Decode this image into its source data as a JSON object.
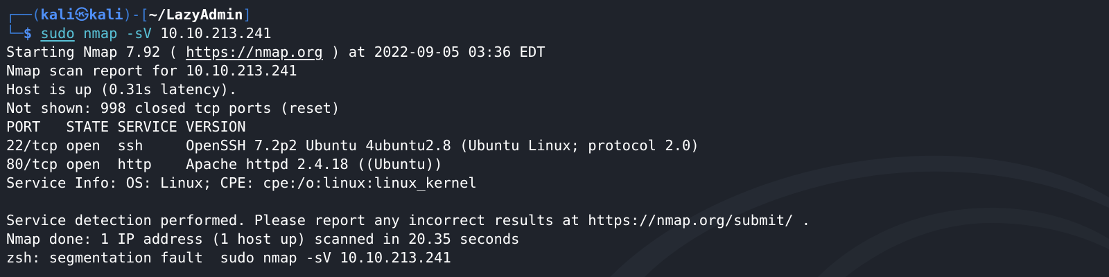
{
  "prompt": {
    "user": "kali",
    "symbol": "㉿",
    "host": "kali",
    "path": "~/LazyAdmin",
    "dollar": "$",
    "command_sudo": "sudo",
    "command_bin": "nmap -sV",
    "command_arg": "10.10.213.241"
  },
  "output": {
    "starting_prefix": "Starting Nmap 7.92 ( ",
    "starting_url": "https://nmap.org",
    "starting_suffix": " ) at 2022-09-05 03:36 EDT",
    "lines": [
      "Nmap scan report for 10.10.213.241",
      "Host is up (0.31s latency).",
      "Not shown: 998 closed tcp ports (reset)",
      "PORT   STATE SERVICE VERSION",
      "22/tcp open  ssh     OpenSSH 7.2p2 Ubuntu 4ubuntu2.8 (Ubuntu Linux; protocol 2.0)",
      "80/tcp open  http    Apache httpd 2.4.18 ((Ubuntu))",
      "Service Info: OS: Linux; CPE: cpe:/o:linux:linux_kernel",
      "",
      "Service detection performed. Please report any incorrect results at https://nmap.org/submit/ .",
      "Nmap done: 1 IP address (1 host up) scanned in 20.35 seconds",
      "zsh: segmentation fault  sudo nmap -sV 10.10.213.241"
    ]
  },
  "colors": {
    "background": "#1f232b",
    "prompt_blue": "#4f8ff7",
    "command_cyan": "#59c2d7",
    "text": "#ffffff"
  }
}
